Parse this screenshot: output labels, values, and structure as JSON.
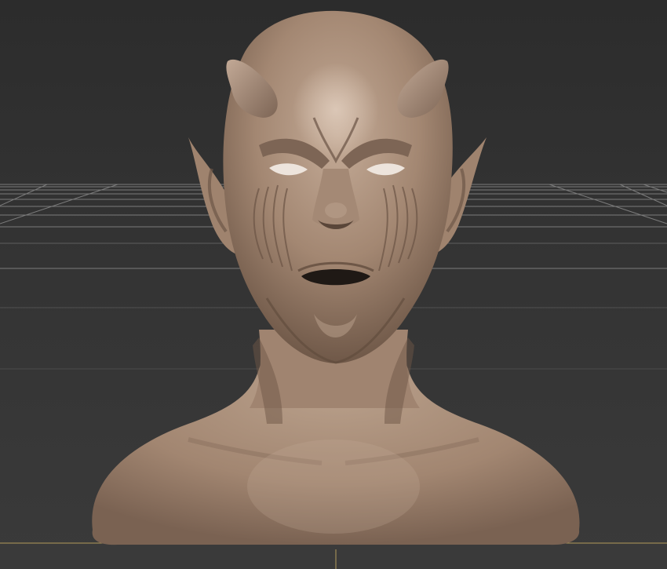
{
  "viewport": {
    "background_color": "#2f2f2f",
    "grid_color": "#8c8c8c",
    "axis_highlight_color": "#b59a57",
    "model_base_color": "#a68a76",
    "model_highlight_color": "#c9b09c",
    "model_shadow_color": "#5e4a3e",
    "model_description_icon": "sculpted-demon-bust-icon"
  }
}
